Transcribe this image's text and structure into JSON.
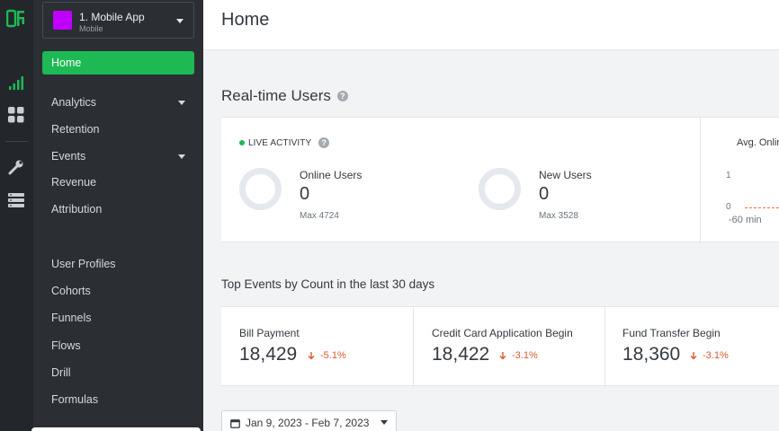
{
  "app": {
    "name": "1. Mobile App",
    "platform": "Mobile",
    "color": "#c000ff"
  },
  "rail": {
    "icons": [
      "logo-icon",
      "bar-chart-icon",
      "dashboard-grid-icon",
      "wrench-icon",
      "database-icon"
    ]
  },
  "sidebar": {
    "items": [
      {
        "label": "Home",
        "active": true
      },
      {
        "label": "Analytics",
        "expandable": true
      },
      {
        "label": "Retention"
      },
      {
        "label": "Events",
        "expandable": true
      },
      {
        "label": "Revenue"
      },
      {
        "label": "Attribution"
      },
      {
        "label": "User Profiles"
      },
      {
        "label": "Cohorts"
      },
      {
        "label": "Funnels"
      },
      {
        "label": "Flows"
      },
      {
        "label": "Drill"
      },
      {
        "label": "Formulas"
      }
    ]
  },
  "header": {
    "title": "Home"
  },
  "realtime": {
    "title": "Real-time Users",
    "help": "?",
    "live_label": "LIVE ACTIVITY",
    "online": {
      "label": "Online Users",
      "value": "0",
      "max": "Max 4724"
    },
    "new_users": {
      "label": "New Users",
      "value": "0",
      "max": "Max 3528"
    },
    "avg_title": "Avg. Online U",
    "axis": {
      "y_top": "1",
      "y_bottom": "0",
      "x_start": "-60 min"
    }
  },
  "top_events": {
    "title": "Top Events by Count in the last 30 days",
    "items": [
      {
        "name": "Bill Payment",
        "value": "18,429",
        "change": "-5.1%"
      },
      {
        "name": "Credit Card Application Begin",
        "value": "18,422",
        "change": "-3.1%"
      },
      {
        "name": "Fund Transfer Begin",
        "value": "18,360",
        "change": "-3.1%"
      }
    ]
  },
  "date_range": {
    "label": "Jan 9, 2023 - Feb 7, 2023"
  },
  "colors": {
    "accent": "#1db954",
    "negative": "#e0572e",
    "sidebar_bg": "#2b2f34",
    "rail_bg": "#23272c"
  }
}
